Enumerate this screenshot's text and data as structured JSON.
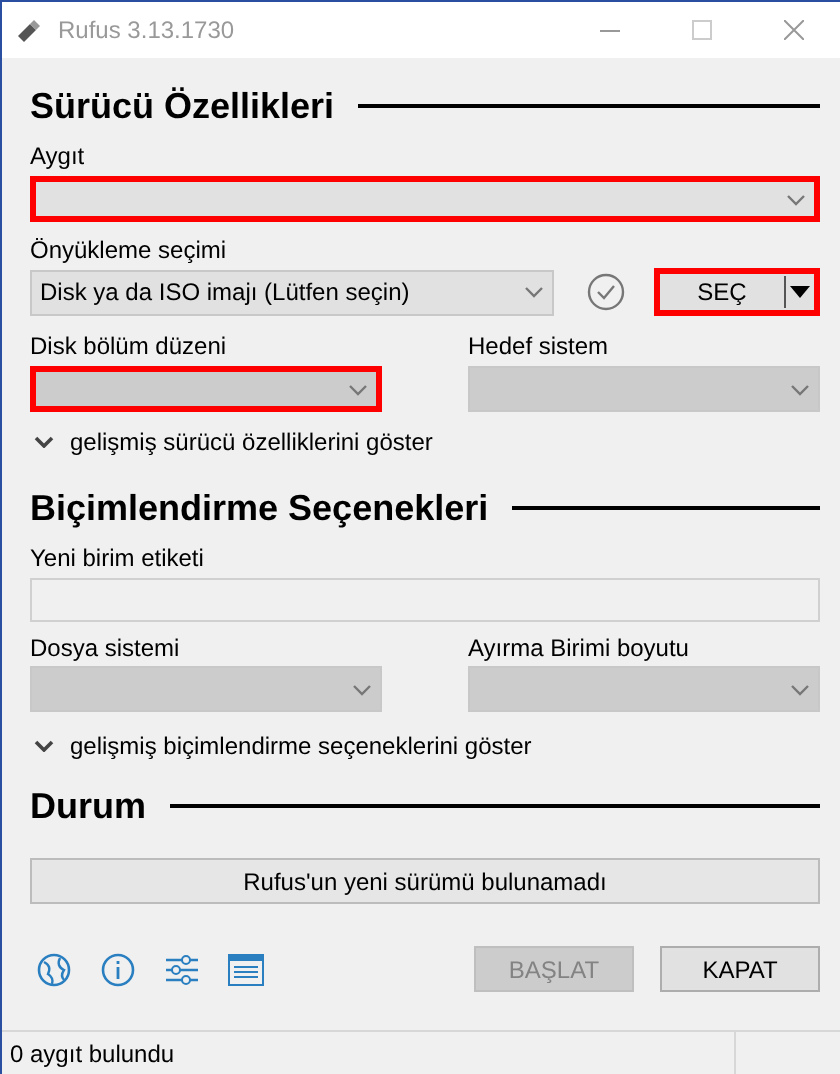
{
  "window": {
    "title": "Rufus 3.13.1730"
  },
  "drive_section": {
    "heading": "Sürücü Özellikleri",
    "device": {
      "label": "Aygıt",
      "highlighted": true,
      "disabled": false
    },
    "boot": {
      "label": "Önyükleme seçimi",
      "value": "Disk ya da ISO imajı (Lütfen seçin)",
      "select_button": {
        "label": "SEÇ",
        "highlighted": true
      }
    },
    "partition": {
      "label": "Disk bölüm düzeni",
      "highlighted": true,
      "disabled": true
    },
    "target": {
      "label": "Hedef sistem",
      "highlighted": false,
      "disabled": true
    },
    "advanced_toggle": {
      "label": "gelişmiş sürücü özelliklerini göster",
      "expanded": false
    }
  },
  "format_section": {
    "heading": "Biçimlendirme Seçenekleri",
    "volume_label": {
      "label": "Yeni birim etiketi"
    },
    "file_system": {
      "label": "Dosya sistemi",
      "highlighted": false,
      "disabled": true
    },
    "cluster_size": {
      "label": "Ayırma Birimi boyutu",
      "highlighted": false,
      "disabled": true
    },
    "advanced_toggle": {
      "label": "gelişmiş biçimlendirme seçeneklerini göster",
      "expanded": false
    }
  },
  "status_section": {
    "heading": "Durum",
    "progress_text": "Rufus'un yeni sürümü bulunamadı"
  },
  "buttons": [
    {
      "label": "BAŞLAT",
      "disabled": true
    },
    {
      "label": "KAPAT",
      "disabled": false
    }
  ],
  "status_bar": {
    "text": "0 aygıt bulundu"
  }
}
